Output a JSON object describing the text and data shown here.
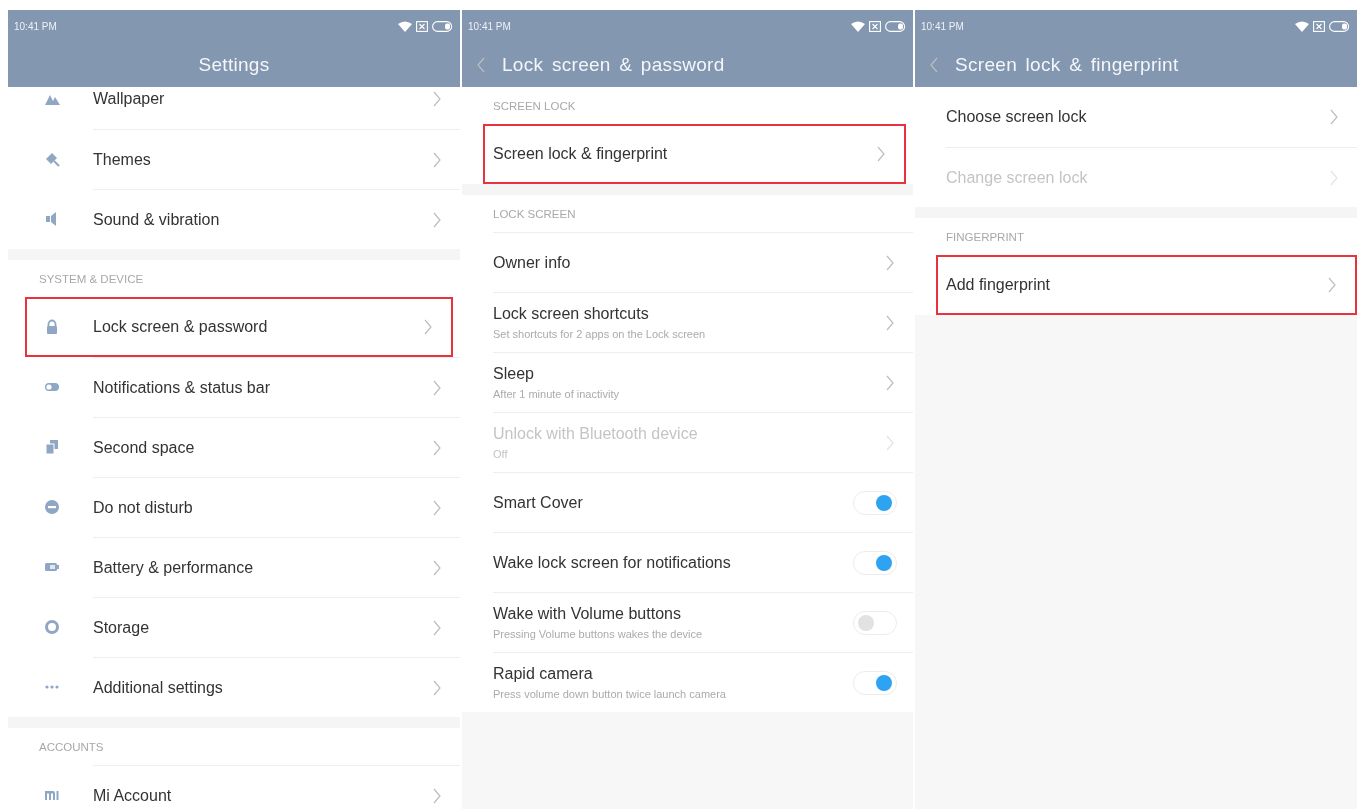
{
  "panels": [
    {
      "time": "10:41 PM",
      "title": "Settings",
      "back": false,
      "sections": [
        {
          "items": [
            {
              "label": "Wallpaper",
              "kind": "chevron"
            },
            {
              "label": "Themes",
              "kind": "chevron"
            },
            {
              "label": "Sound & vibration",
              "kind": "chevron"
            }
          ]
        },
        {
          "header": "SYSTEM & DEVICE",
          "items": [
            {
              "label": "Lock screen & password",
              "kind": "chevron",
              "highlighted": true
            },
            {
              "label": "Notifications & status bar",
              "kind": "chevron"
            },
            {
              "label": "Second space",
              "kind": "chevron"
            },
            {
              "label": "Do not disturb",
              "kind": "chevron"
            },
            {
              "label": "Battery & performance",
              "kind": "chevron"
            },
            {
              "label": "Storage",
              "kind": "chevron"
            },
            {
              "label": "Additional settings",
              "kind": "chevron"
            }
          ]
        },
        {
          "header": "ACCOUNTS",
          "items": [
            {
              "label": "Mi Account",
              "kind": "chevron"
            }
          ]
        }
      ]
    },
    {
      "time": "10:41 PM",
      "title": "Lock screen & password",
      "back": true,
      "sections": [
        {
          "header": "SCREEN LOCK",
          "items": [
            {
              "label": "Screen lock & fingerprint",
              "kind": "chevron",
              "highlighted": true
            }
          ]
        },
        {
          "header": "LOCK SCREEN",
          "items": [
            {
              "label": "Owner info",
              "kind": "chevron"
            },
            {
              "label": "Lock screen shortcuts",
              "sublabel": "Set shortcuts for 2 apps on the Lock screen",
              "kind": "chevron"
            },
            {
              "label": "Sleep",
              "sublabel": "After 1 minute of inactivity",
              "kind": "chevron"
            },
            {
              "label": "Unlock with Bluetooth device",
              "sublabel": "Off",
              "kind": "chevron",
              "disabled": true
            },
            {
              "label": "Smart Cover",
              "kind": "toggle",
              "on": true
            },
            {
              "label": "Wake lock screen for notifications",
              "kind": "toggle",
              "on": true
            },
            {
              "label": "Wake with Volume buttons",
              "sublabel": "Pressing Volume buttons wakes the device",
              "kind": "toggle",
              "on": false
            },
            {
              "label": "Rapid camera",
              "sublabel": "Press volume down button twice launch camera",
              "kind": "toggle",
              "on": true
            }
          ]
        }
      ]
    },
    {
      "time": "10:41 PM",
      "title": "Screen lock & fingerprint",
      "back": true,
      "sections": [
        {
          "items": [
            {
              "label": "Choose screen lock",
              "kind": "chevron"
            },
            {
              "label": "Change screen lock",
              "kind": "chevron",
              "disabled": true
            }
          ]
        },
        {
          "header": "FINGERPRINT",
          "items": [
            {
              "label": "Add fingerprint",
              "kind": "chevron",
              "highlighted": true
            }
          ]
        }
      ]
    }
  ]
}
